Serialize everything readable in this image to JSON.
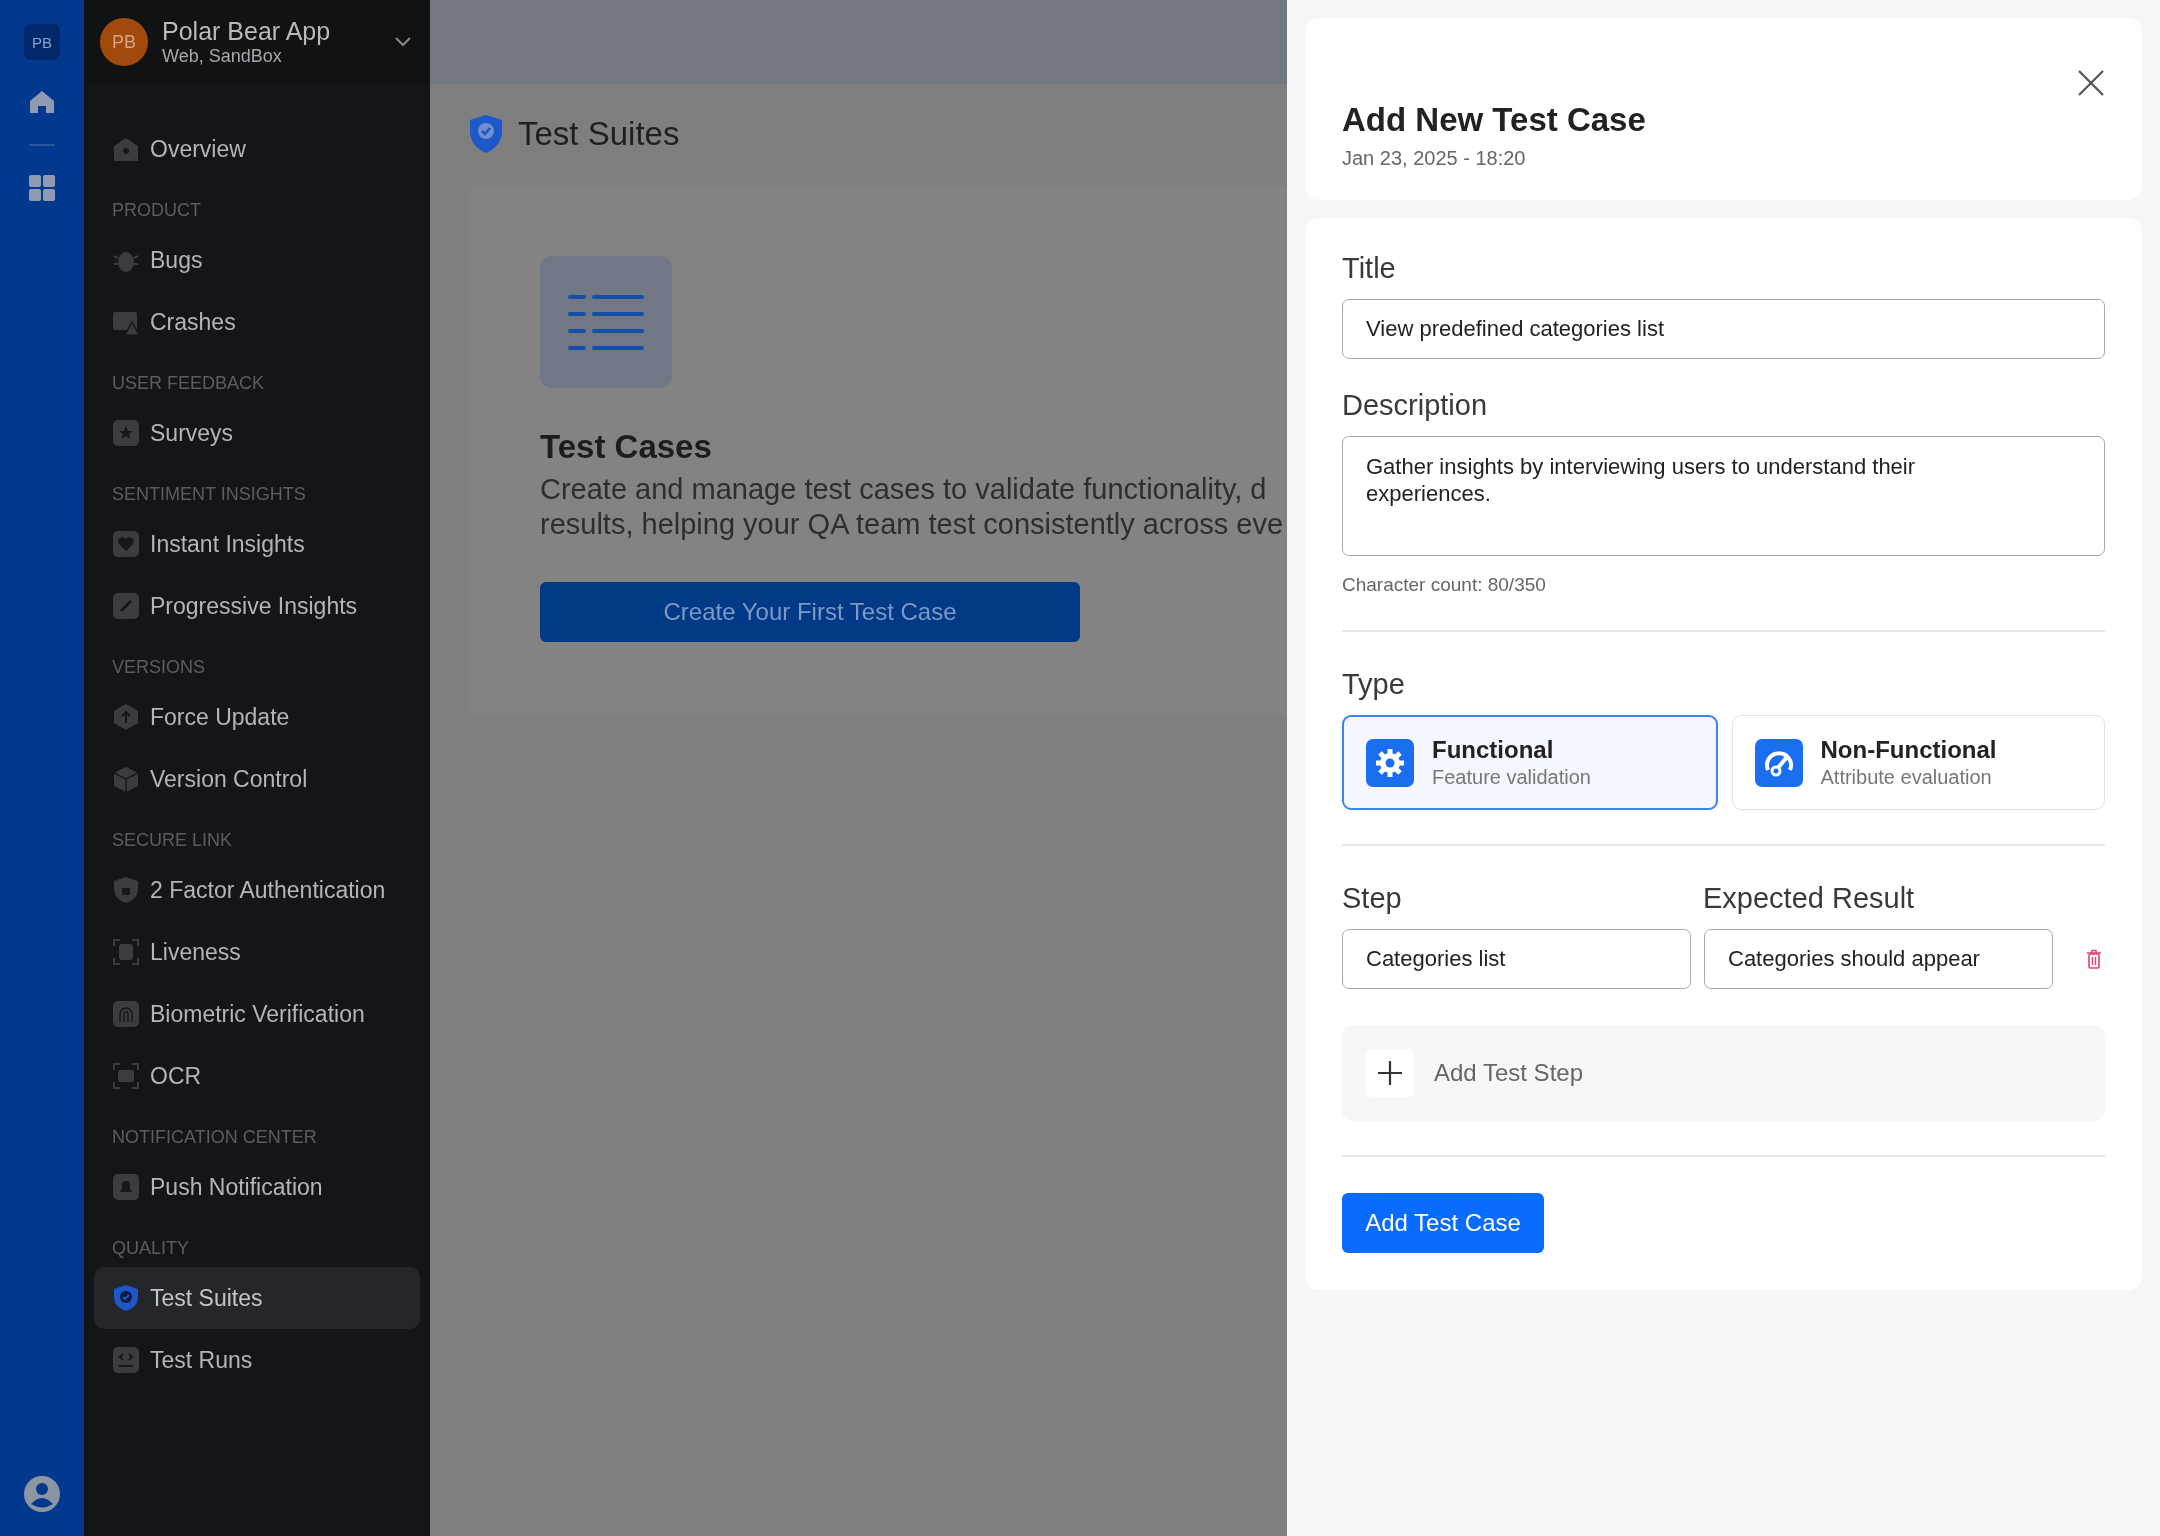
{
  "rail": {
    "logo": "PB"
  },
  "workspace": {
    "avatar": "PB",
    "name": "Polar Bear App",
    "subtitle": "Web, SandBox"
  },
  "nav": {
    "top": [
      {
        "label": "Overview",
        "selected": false
      }
    ],
    "sections": [
      {
        "title": "PRODUCT",
        "items": [
          {
            "label": "Bugs",
            "selected": false
          },
          {
            "label": "Crashes",
            "selected": false
          }
        ]
      },
      {
        "title": "USER FEEDBACK",
        "items": [
          {
            "label": "Surveys",
            "selected": false
          }
        ]
      },
      {
        "title": "SENTIMENT INSIGHTS",
        "items": [
          {
            "label": "Instant Insights",
            "selected": false
          },
          {
            "label": "Progressive Insights",
            "selected": false
          }
        ]
      },
      {
        "title": "VERSIONS",
        "items": [
          {
            "label": "Force Update",
            "selected": false
          },
          {
            "label": "Version Control",
            "selected": false
          }
        ]
      },
      {
        "title": "SECURE LINK",
        "items": [
          {
            "label": "2 Factor Authentication",
            "selected": false
          },
          {
            "label": "Liveness",
            "selected": false
          },
          {
            "label": "Biometric Verification",
            "selected": false
          },
          {
            "label": "OCR",
            "selected": false
          }
        ]
      },
      {
        "title": "NOTIFICATION CENTER",
        "items": [
          {
            "label": "Push Notification",
            "selected": false
          }
        ]
      },
      {
        "title": "QUALITY",
        "items": [
          {
            "label": "Test Suites",
            "selected": true
          },
          {
            "label": "Test Runs",
            "selected": false
          }
        ]
      }
    ]
  },
  "page": {
    "title": "Test Suites",
    "empty_state": {
      "title": "Test Cases",
      "description_lines": [
        "Create and manage test cases to validate functionality, d",
        "results, helping your QA team test consistently across eve"
      ],
      "button": "Create Your First Test Case"
    }
  },
  "drawer": {
    "title": "Add New Test Case",
    "date": "Jan 23, 2025 - 18:20",
    "title_label": "Title",
    "title_value": "View predefined categories list",
    "description_label": "Description",
    "description_value": "Gather insights by interviewing users to understand their experiences.",
    "char_count": "Character count: 80/350",
    "type_label": "Type",
    "types": [
      {
        "name": "Functional",
        "subtitle": "Feature validation",
        "selected": true
      },
      {
        "name": "Non-Functional",
        "subtitle": "Attribute evaluation",
        "selected": false
      }
    ],
    "step_label": "Step",
    "expected_label": "Expected Result",
    "steps": [
      {
        "step": "Categories list",
        "expected": "Categories should appear"
      }
    ],
    "add_step": "Add Test Step",
    "submit": "Add Test Case"
  }
}
